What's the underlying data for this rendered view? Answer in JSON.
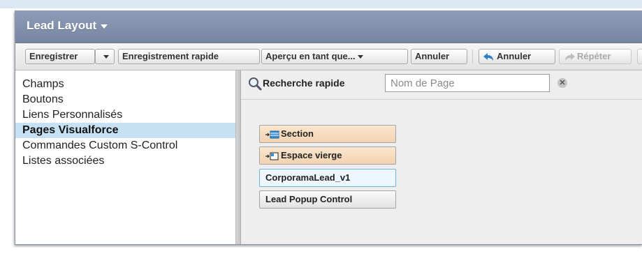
{
  "window": {
    "title": "Lead Layout"
  },
  "toolbar": {
    "save": "Enregistrer",
    "quick_save": "Enregistrement rapide",
    "preview_as": "Aperçu en tant que...",
    "cancel": "Annuler",
    "undo": "Annuler",
    "redo": "Répéter"
  },
  "sidebar": {
    "items": [
      {
        "label": "Champs",
        "selected": false
      },
      {
        "label": "Boutons",
        "selected": false
      },
      {
        "label": "Liens Personnalisés",
        "selected": false
      },
      {
        "label": "Pages Visualforce",
        "selected": true
      },
      {
        "label": "Commandes Custom S-Control",
        "selected": false
      },
      {
        "label": "Listes associées",
        "selected": false
      }
    ]
  },
  "quick_find": {
    "label": "Recherche rapide",
    "placeholder": "Nom de Page",
    "value": ""
  },
  "palette": {
    "items": [
      {
        "label": "Section",
        "type": "section"
      },
      {
        "label": "Espace vierge",
        "type": "blank-space"
      },
      {
        "label": "CorporamaLead_v1",
        "type": "visualforce-page"
      },
      {
        "label": "Lead Popup Control",
        "type": "visualforce-page"
      }
    ]
  },
  "colors": {
    "title_bar": "#8391ac",
    "selected_item": "#c6e1f3",
    "special_item": "#f6dcbd",
    "hover_item_border": "#6fb3df"
  }
}
